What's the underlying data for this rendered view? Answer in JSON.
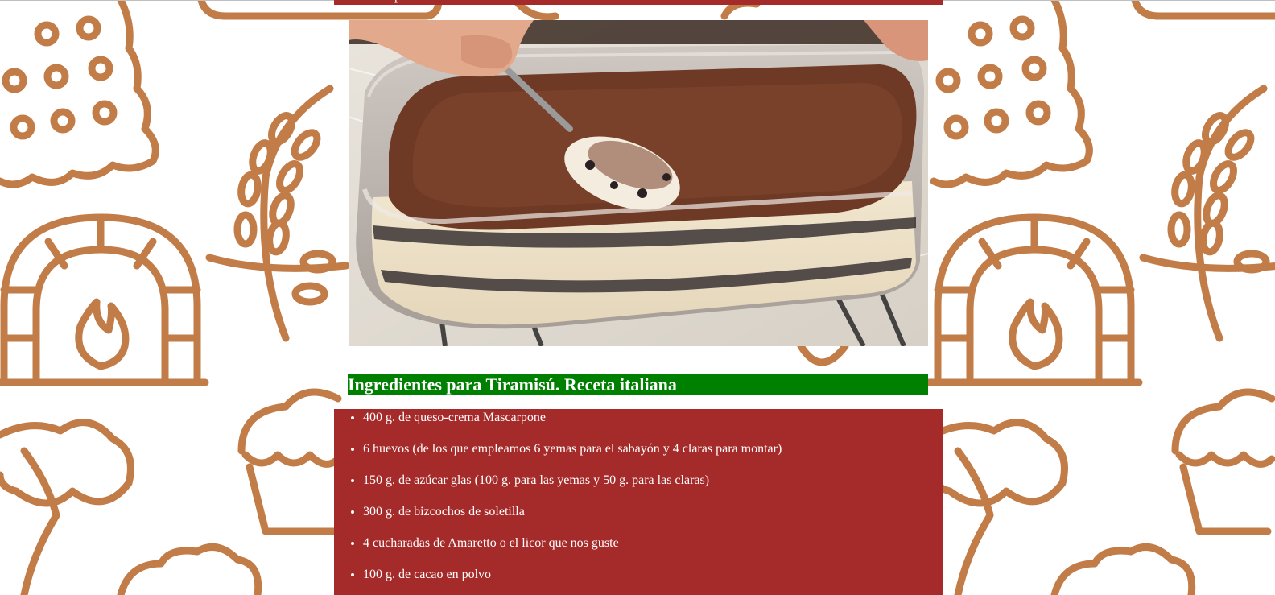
{
  "colors": {
    "pattern": "#c27c47",
    "list_background": "#a52a2a",
    "heading_background": "#008000",
    "text": "#ffffff"
  },
  "hero": {
    "image_alt": "Tiramisú en fuente de cristal con cuchara"
  },
  "top_fragment": "p",
  "ingredients": {
    "heading": "Ingredientes para Tiramisú. Receta italiana",
    "items": [
      "400 g. de queso-crema Mascarpone",
      "6 huevos (de los que empleamos 6 yemas para el sabayón y 4 claras para montar)",
      "150 g. de azúcar glas (100 g. para las yemas y 50 g. para las claras)",
      "300 g. de bizcochos de soletilla",
      "4 cucharadas de Amaretto o el licor que nos guste",
      "100 g. de cacao en polvo"
    ]
  }
}
